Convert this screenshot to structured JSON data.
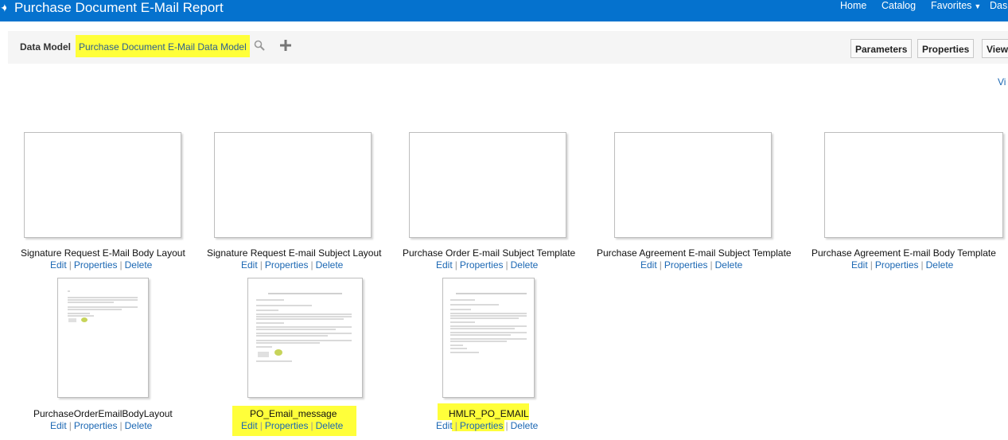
{
  "header": {
    "title": "Purchase Document E-Mail Report",
    "nav": [
      "Home",
      "Catalog",
      "Favorites",
      "Dash"
    ]
  },
  "toolbar": {
    "data_model_label": "Data Model",
    "data_model_value": "Purchase Document E-Mail Data Model",
    "buttons": [
      "Parameters",
      "Properties",
      "View"
    ]
  },
  "view_link": "Vi",
  "layouts": [
    {
      "name": "Signature Request E-Mail Body Layout",
      "actions": [
        "Edit",
        "Properties",
        "Delete"
      ]
    },
    {
      "name": "Signature Request E-mail Subject Layout",
      "actions": [
        "Edit",
        "Properties",
        "Delete"
      ]
    },
    {
      "name": "Purchase Order E-mail Subject Template",
      "actions": [
        "Edit",
        "Properties",
        "Delete"
      ]
    },
    {
      "name": "Purchase Agreement E-mail Subject Template",
      "actions": [
        "Edit",
        "Properties",
        "Delete"
      ]
    },
    {
      "name": "Purchase Agreement E-mail Body Template",
      "actions": [
        "Edit",
        "Properties",
        "Delete"
      ]
    },
    {
      "name": "PurchaseOrderEmailBodyLayout",
      "actions": [
        "Edit",
        "Properties",
        "Delete"
      ]
    },
    {
      "name": "PO_Email_message",
      "actions": [
        "Edit",
        "Properties",
        "Delete"
      ]
    },
    {
      "name": "HMLR_PO_EMAIL",
      "actions": [
        "Edit",
        "Properties",
        "Delete"
      ]
    }
  ],
  "colors": {
    "header": "#0572ce",
    "highlight": "#ffff3a",
    "link": "#1b67b3"
  }
}
